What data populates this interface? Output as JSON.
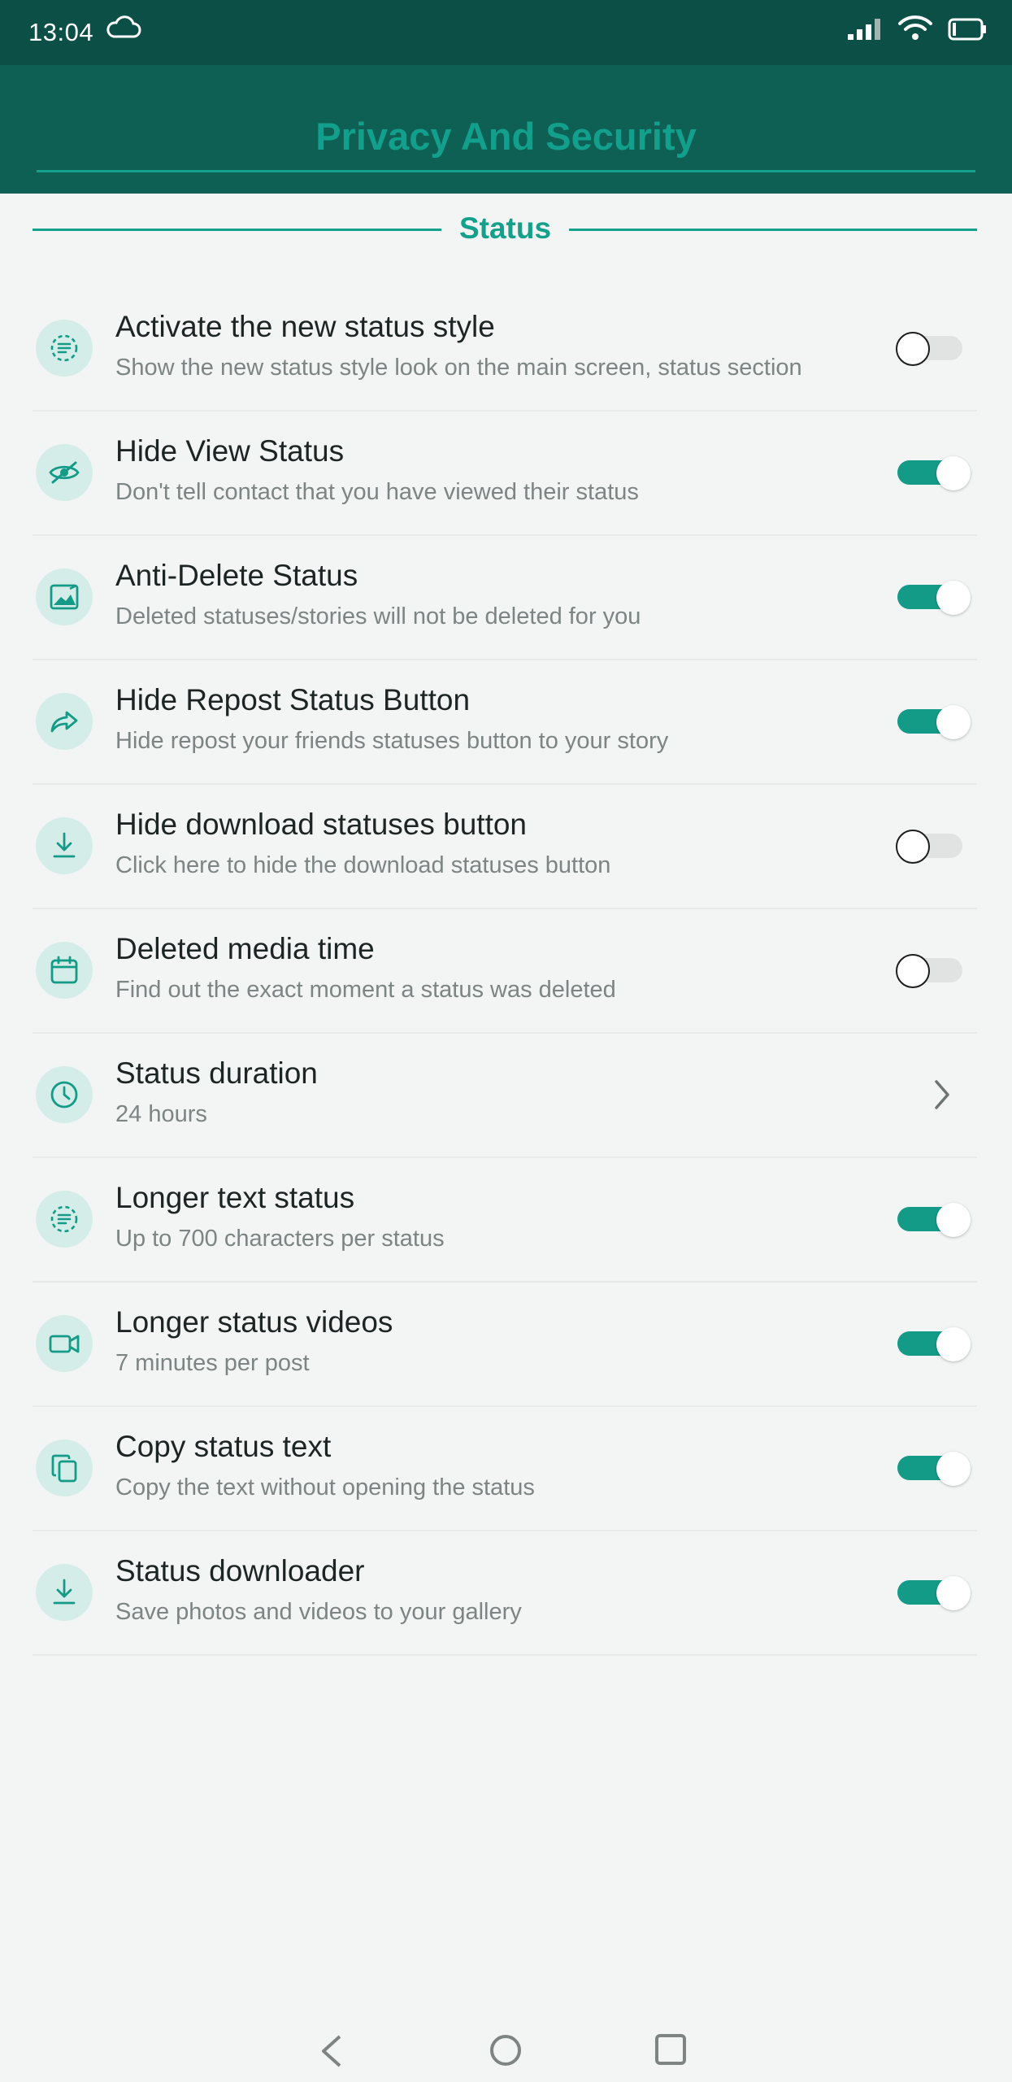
{
  "status_bar": {
    "time": "13:04"
  },
  "header": {
    "title": "Privacy And Security"
  },
  "section": {
    "title": "Status"
  },
  "colors": {
    "accent": "#14a08b",
    "header_bg": "#0e5f54",
    "status_bar_bg": "#0c4f47",
    "icon_bg": "#d5ede8"
  },
  "settings": [
    {
      "icon": "dashed-circle-text-icon",
      "title": "Activate the new status style",
      "subtitle": "Show the new status style look on the main screen, status section",
      "control": "toggle",
      "checked": false
    },
    {
      "icon": "eye-off-icon",
      "title": "Hide View Status",
      "subtitle": "Don't tell contact that you have viewed their status",
      "control": "toggle",
      "checked": true
    },
    {
      "icon": "image-icon",
      "title": "Anti-Delete Status",
      "subtitle": "Deleted statuses/stories will not be deleted for you",
      "control": "toggle",
      "checked": true
    },
    {
      "icon": "share-arrow-icon",
      "title": "Hide Repost Status Button",
      "subtitle": "Hide repost your friends statuses button to your story",
      "control": "toggle",
      "checked": true
    },
    {
      "icon": "download-icon",
      "title": "Hide download statuses button",
      "subtitle": "Click here to hide the download statuses button",
      "control": "toggle",
      "checked": false
    },
    {
      "icon": "calendar-icon",
      "title": "Deleted media time",
      "subtitle": "Find out the exact moment a status was deleted",
      "control": "toggle",
      "checked": false
    },
    {
      "icon": "clock-icon",
      "title": "Status duration",
      "subtitle": "24 hours",
      "control": "chevron",
      "checked": null
    },
    {
      "icon": "dashed-circle-text-icon",
      "title": "Longer text status",
      "subtitle": "Up to 700 characters per status",
      "control": "toggle",
      "checked": true
    },
    {
      "icon": "video-camera-icon",
      "title": "Longer status videos",
      "subtitle": "7 minutes per post",
      "control": "toggle",
      "checked": true
    },
    {
      "icon": "copy-icon",
      "title": "Copy status text",
      "subtitle": "Copy the text without opening the status",
      "control": "toggle",
      "checked": true
    },
    {
      "icon": "download-icon",
      "title": "Status downloader",
      "subtitle": "Save photos and videos to your gallery",
      "control": "toggle",
      "checked": true
    }
  ],
  "nav_bar": {
    "back": "back-triangle-icon",
    "home": "home-circle-icon",
    "recent": "recent-apps-square-icon"
  }
}
